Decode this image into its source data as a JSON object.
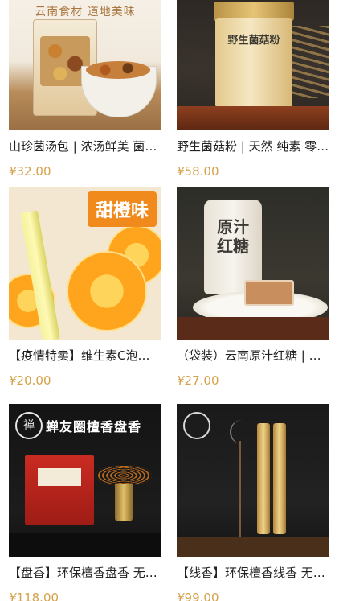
{
  "products": [
    {
      "title": "山珍菌汤包 | 浓汤鲜美 菌菇营养",
      "currency": "¥",
      "price": "32.00",
      "image_banner": "云南食材  道地美味"
    },
    {
      "title": "野生菌菇粉 | 天然 纯素 零添加",
      "currency": "¥",
      "price": "58.00",
      "image_label": "野生菌菇粉"
    },
    {
      "title": "【疫情特卖】维生素C泡腾片",
      "currency": "¥",
      "price": "20.00",
      "image_tag": "甜橙味"
    },
    {
      "title": "（袋装）云南原汁红糖 | 古法手工",
      "currency": "¥",
      "price": "27.00",
      "image_label": "原汁红糖"
    },
    {
      "title": "【盘香】环保檀香盘香 无烟安神",
      "currency": "¥",
      "price": "118.00",
      "image_heading": "蝉友圈檀香盘香"
    },
    {
      "title": "【线香】环保檀香线香 无烟安神",
      "currency": "¥",
      "price": "99.00"
    }
  ],
  "colors": {
    "price": "#d4a24a",
    "title": "#222222",
    "background": "#ffffff"
  }
}
